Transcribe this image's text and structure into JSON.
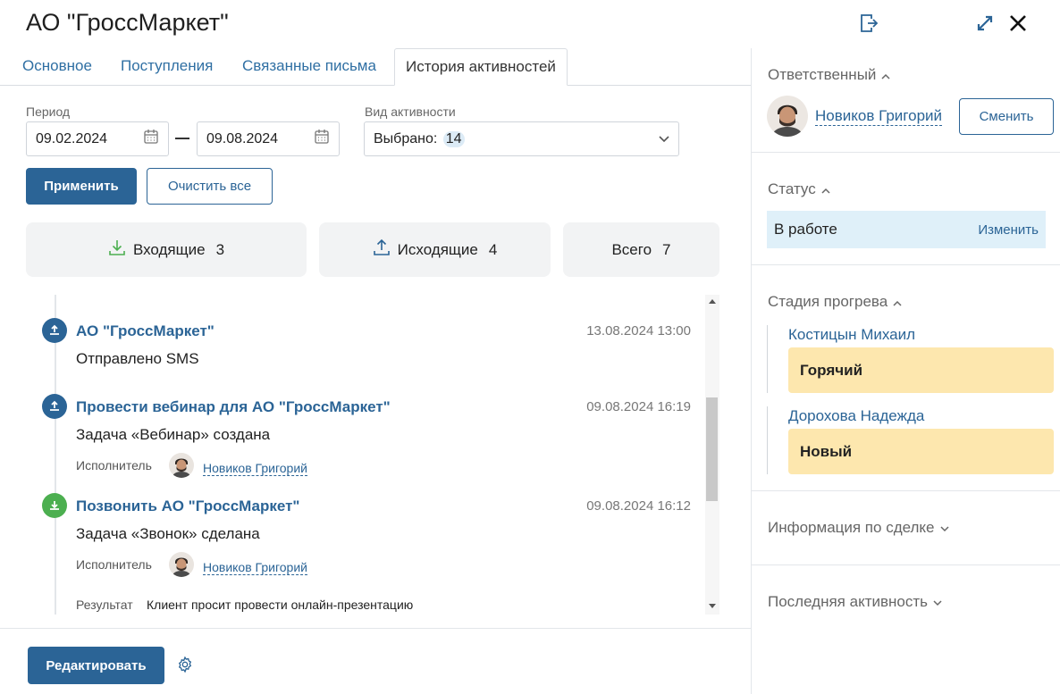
{
  "header": {
    "title": "АО \"ГроссМаркет\"",
    "icons": [
      "export-icon",
      "expand-icon",
      "close-icon"
    ]
  },
  "tabs": [
    {
      "label": "Основное",
      "active": false
    },
    {
      "label": "Поступления",
      "active": false
    },
    {
      "label": "Связанные письма",
      "active": false
    },
    {
      "label": "История активностей",
      "active": true
    }
  ],
  "filters": {
    "period_label": "Период",
    "date_from": "09.02.2024",
    "date_to": "09.08.2024",
    "activity_label": "Вид активности",
    "activity_value_prefix": "Выбрано:",
    "activity_count": "14",
    "apply_label": "Применить",
    "clear_label": "Очистить все"
  },
  "stats": {
    "incoming_label": "Входящие",
    "incoming_count": "3",
    "outgoing_label": "Исходящие",
    "outgoing_count": "4",
    "total_label": "Всего",
    "total_count": "7"
  },
  "events": [
    {
      "direction": "outgoing",
      "title": "АО \"ГроссМаркет\"",
      "time": "13.08.2024 13:00",
      "desc": "Отправлено SMS"
    },
    {
      "direction": "outgoing",
      "title": "Провести вебинар для АО \"ГроссМаркет\"",
      "time": "09.08.2024 16:19",
      "desc": "Задача «Вебинар» создана",
      "executor_label": "Исполнитель",
      "executor": "Новиков Григорий"
    },
    {
      "direction": "incoming",
      "title": "Позвонить АО \"ГроссМаркет\"",
      "time": "09.08.2024 16:12",
      "desc": "Задача «Звонок» сделана",
      "executor_label": "Исполнитель",
      "executor": "Новиков Григорий",
      "result_label": "Результат",
      "result": "Клиент просит провести онлайн-презентацию"
    }
  ],
  "footer": {
    "edit_label": "Редактировать"
  },
  "right": {
    "responsible_title": "Ответственный",
    "responsible_name": "Новиков Григорий",
    "change_label": "Сменить",
    "status_title": "Статус",
    "status_value": "В работе",
    "status_change": "Изменить",
    "stage_title": "Стадия прогрева",
    "stages": [
      {
        "person": "Костицын Михаил",
        "value": "Горячий"
      },
      {
        "person": "Дорохова Надежда",
        "value": "Новый"
      }
    ],
    "deal_info_title": "Информация по сделке",
    "last_activity_title": "Последняя активность"
  },
  "colors": {
    "primary": "#2b6496",
    "outgoing_icon": "#2b6496",
    "incoming_icon": "#4caf50",
    "status_bg": "#dff0f9",
    "stage_bg": "#fde7ae"
  }
}
